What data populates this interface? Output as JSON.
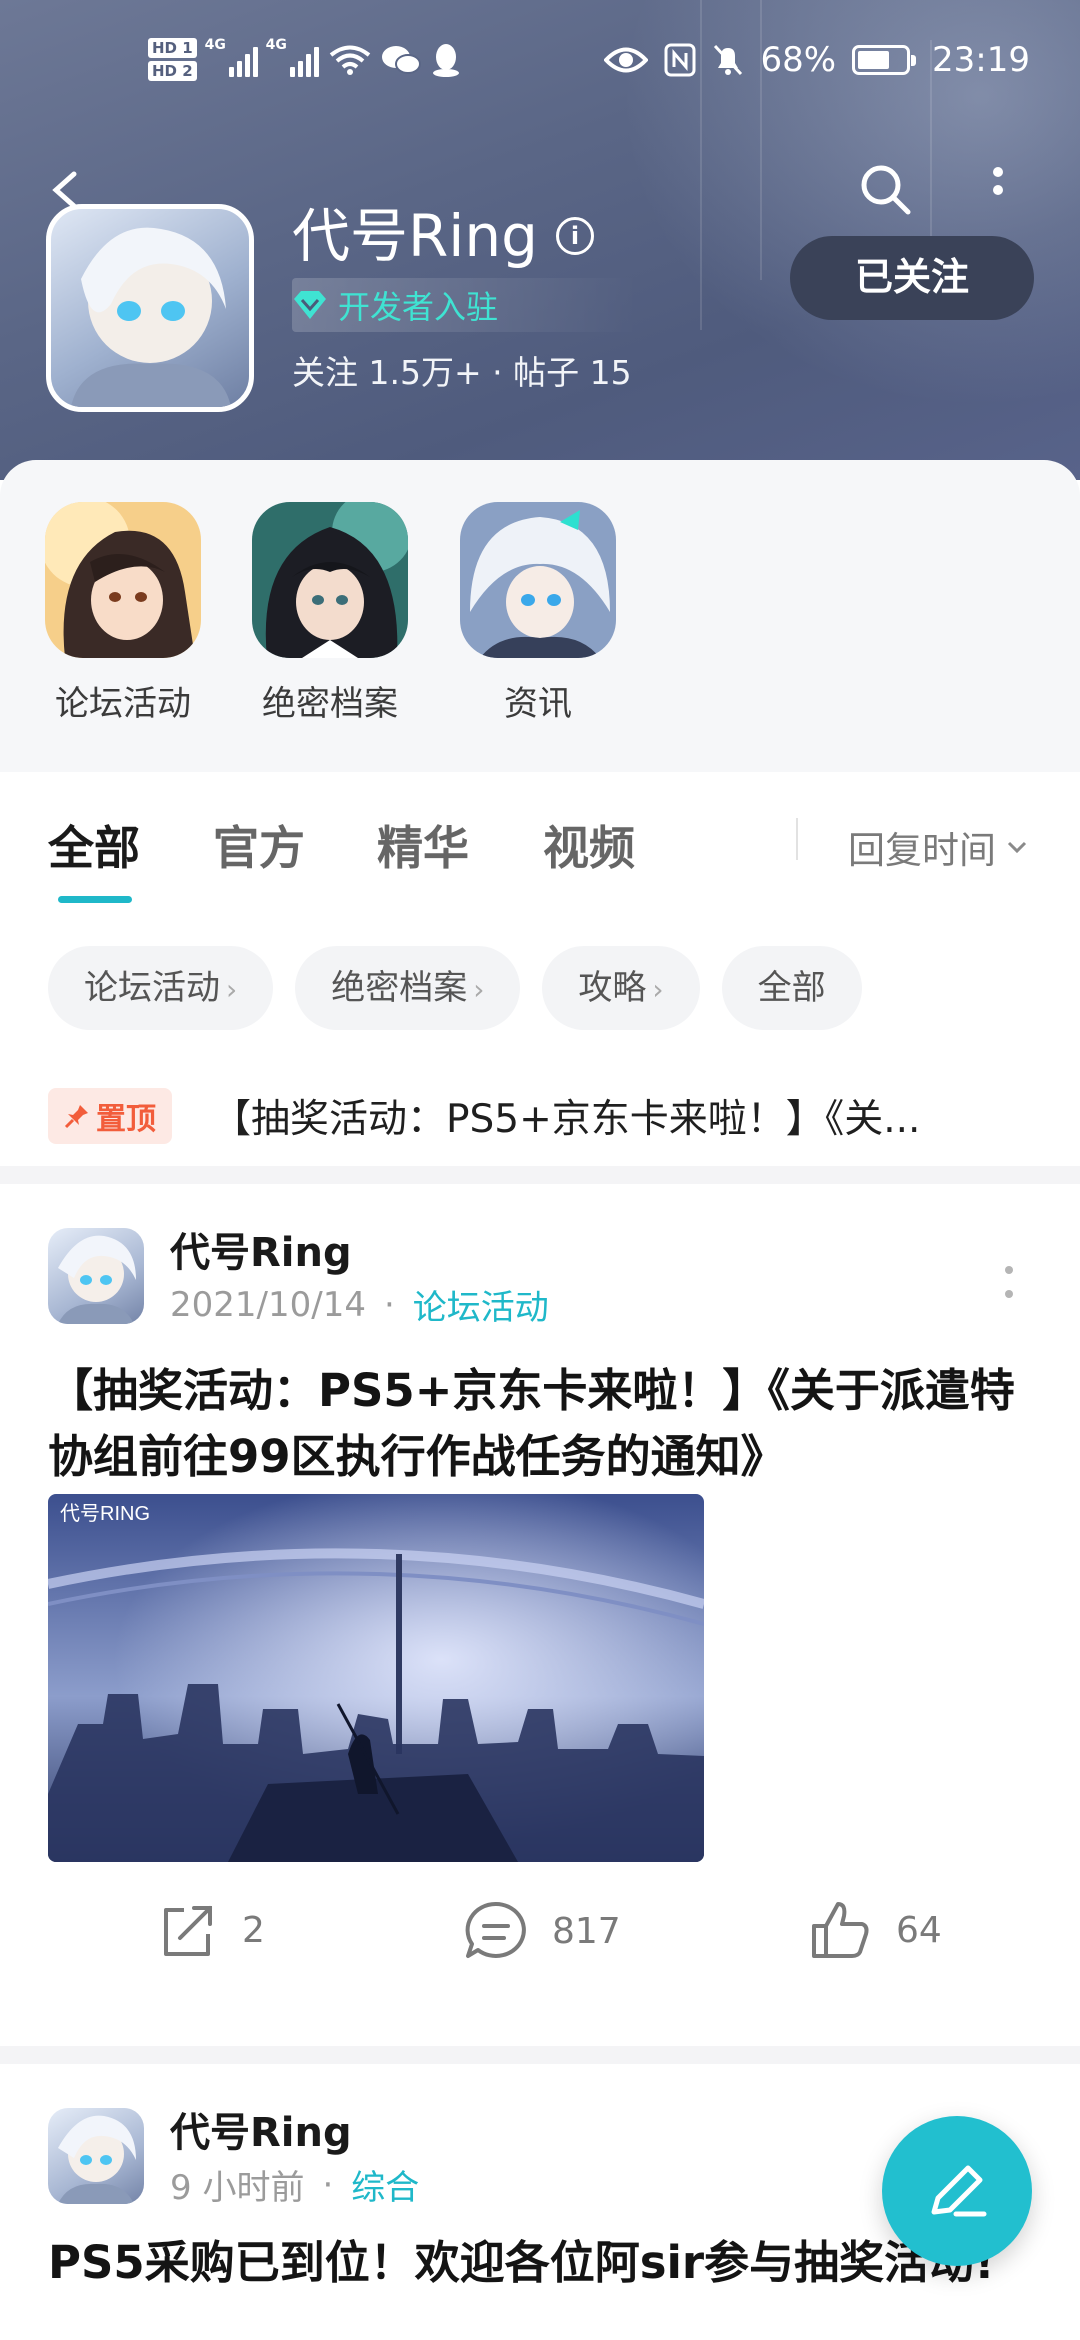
{
  "status_bar": {
    "hd1": "HD 1",
    "hd2": "HD 2",
    "net1": "4G",
    "net2": "4G",
    "battery_percent": "68%",
    "battery_level": 0.68,
    "time": "23:19"
  },
  "header": {
    "forum_name": "代号Ring",
    "developer_badge": "开发者入驻",
    "stats": "关注 1.5万+ · 帖子 15",
    "follow_button": "已关注"
  },
  "shortcuts": [
    {
      "label": "论坛活动"
    },
    {
      "label": "绝密档案"
    },
    {
      "label": "资讯"
    }
  ],
  "tabs": [
    {
      "label": "全部",
      "active": true
    },
    {
      "label": "官方"
    },
    {
      "label": "精华"
    },
    {
      "label": "视频"
    }
  ],
  "sort": {
    "label": "回复时间"
  },
  "chips": [
    {
      "label": "论坛活动",
      "arrow": "›"
    },
    {
      "label": "绝密档案",
      "arrow": "›"
    },
    {
      "label": "攻略",
      "arrow": "›"
    },
    {
      "label": "全部",
      "arrow": ""
    }
  ],
  "pinned": {
    "badge": "置顶",
    "text": "【抽奖活动：PS5+京东卡来啦！】《关..."
  },
  "posts": [
    {
      "author": "代号Ring",
      "date": "2021/10/14",
      "category": "论坛活动",
      "title": "【抽奖活动：PS5+京东卡来啦！】《关于派遣特协组前往99区执行作战任务的通知》",
      "cover_logo": "代号RING",
      "share_count": "2",
      "comment_count": "817",
      "like_count": "64"
    },
    {
      "author": "代号Ring",
      "date": "9 小时前",
      "category": "综合",
      "title": "PS5采购已到位！欢迎各位阿sir参与抽奖活动!"
    }
  ],
  "colors": {
    "accent": "#1fb8c9",
    "pin": "#f25d3b",
    "header": "#5a6686"
  }
}
